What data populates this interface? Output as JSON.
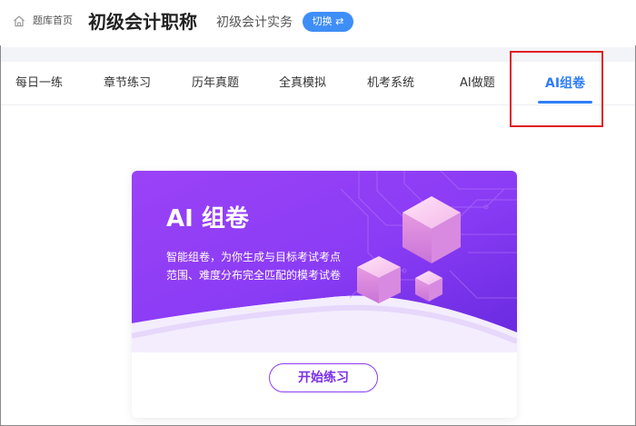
{
  "header": {
    "home_label": "题库首页",
    "title": "初级会计职称",
    "subject": "初级会计实务",
    "switch_label": "切换 ⇄",
    "home_icon": "home-icon"
  },
  "tabs": [
    {
      "label": "每日一练",
      "active": false
    },
    {
      "label": "章节练习",
      "active": false
    },
    {
      "label": "历年真题",
      "active": false
    },
    {
      "label": "全真模拟",
      "active": false
    },
    {
      "label": "机考系统",
      "active": false
    },
    {
      "label": "AI做题",
      "active": false
    },
    {
      "label": "AI组卷",
      "active": true
    }
  ],
  "card": {
    "title": "AI 组卷",
    "desc_line1": "智能组卷，为你生成与目标考试考点",
    "desc_line2": "范围、难度分布完全匹配的模考试卷",
    "start_label": "开始练习"
  },
  "colors": {
    "accent_blue": "#2f7df6",
    "switch_blue": "#3e8ef7",
    "banner_purple": "#8a3cf5",
    "highlight_red": "#e0201e"
  }
}
